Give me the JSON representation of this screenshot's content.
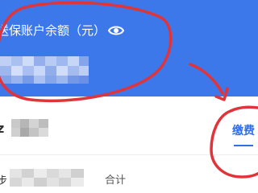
{
  "account": {
    "balance_label": "送保账户余额（元）",
    "balance_icon": "eye-icon",
    "balance_value": ""
  },
  "tabs": {
    "pay_label": "缴费"
  },
  "rows": [
    {
      "prefix": "z",
      "name": ""
    },
    {
      "prefix": "步",
      "name": "",
      "total_label": "合计"
    }
  ],
  "colors": {
    "header_blue": "#3c78ea",
    "tab_blue": "#2f6fe6",
    "annotation_red": "#e0343b"
  }
}
